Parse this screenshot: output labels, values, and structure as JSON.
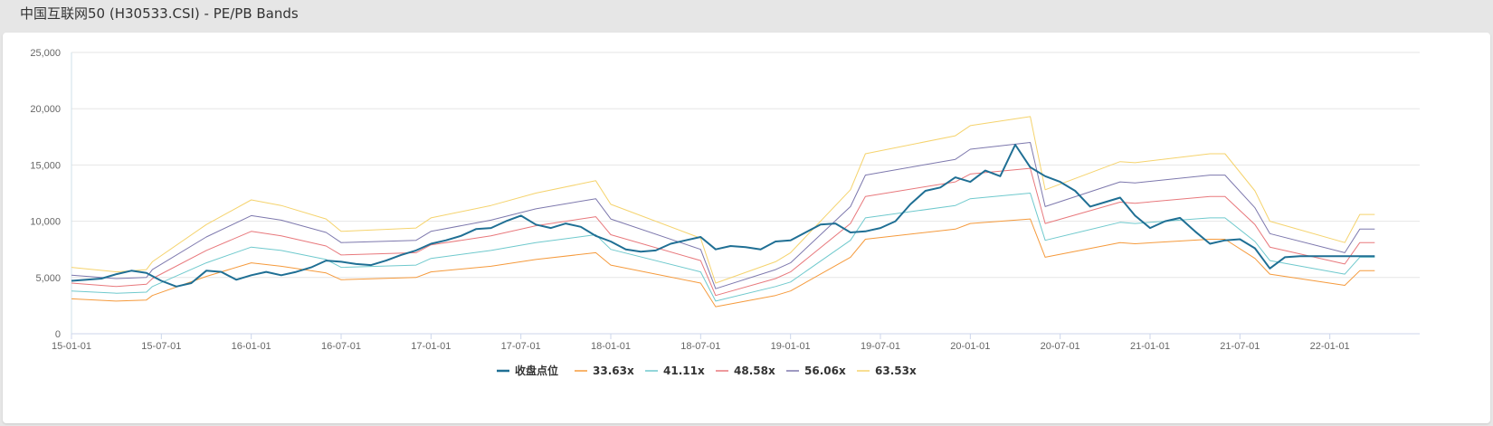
{
  "title": "中国互联网50 (H30533.CSI) - PE/PB Bands",
  "chart_data": {
    "type": "line",
    "title": "中国互联网50 (H30533.CSI) - PE/PB Bands",
    "xlabel": "",
    "ylabel": "",
    "x_ticks": [
      "15-01-01",
      "15-07-01",
      "16-01-01",
      "16-07-01",
      "17-01-01",
      "17-07-01",
      "18-01-01",
      "18-07-01",
      "19-01-01",
      "19-07-01",
      "20-01-01",
      "20-07-01",
      "21-01-01",
      "21-07-01",
      "22-01-01"
    ],
    "ylim": [
      0,
      25000
    ],
    "y_ticks": [
      0,
      5000,
      10000,
      15000,
      20000,
      25000
    ],
    "y_tick_labels": [
      "0",
      "5,000",
      "10,000",
      "15,000",
      "20,000",
      "25,000"
    ],
    "grid": true,
    "legend_position": "bottom",
    "x_unit": "months since 2015-01",
    "series": [
      {
        "name": "收盘点位",
        "color": "#1f6f94",
        "width": 2,
        "x": [
          0,
          1,
          2,
          3,
          4,
          5,
          6,
          7,
          8,
          9,
          10,
          11,
          12,
          13,
          14,
          15,
          16,
          17,
          18,
          19,
          20,
          21,
          22,
          23,
          24,
          25,
          26,
          27,
          28,
          29,
          30,
          31,
          32,
          33,
          34,
          35,
          36,
          37,
          38,
          39,
          40,
          41,
          42,
          43,
          44,
          45,
          46,
          47,
          48,
          49,
          50,
          51,
          52,
          53,
          54,
          55,
          56,
          57,
          58,
          59,
          60,
          61,
          62,
          63,
          64,
          65,
          66,
          67,
          68,
          69,
          70,
          71,
          72,
          73,
          74,
          75,
          76,
          77,
          78,
          79,
          80,
          81,
          82,
          83,
          84,
          85,
          86,
          87
        ],
        "values": [
          4700,
          4800,
          4900,
          5300,
          5600,
          5400,
          4700,
          4200,
          4500,
          5600,
          5500,
          4800,
          5200,
          5500,
          5200,
          5500,
          5900,
          6500,
          6400,
          6200,
          6100,
          6500,
          7000,
          7400,
          8000,
          8300,
          8700,
          9300,
          9400,
          10000,
          10500,
          9700,
          9400,
          9800,
          9500,
          8700,
          8200,
          7500,
          7300,
          7400,
          8000,
          8300,
          8600,
          7500,
          7800,
          7700,
          7500,
          8200,
          8300,
          9000,
          9700,
          9800,
          9000,
          9100,
          9400,
          10000,
          11500,
          12700,
          13000,
          13900,
          13500,
          14500,
          14000,
          16800,
          14800,
          14000,
          13500,
          12700,
          11300,
          11700,
          12100,
          10500,
          9400,
          10000,
          10300,
          9100,
          8000,
          8300,
          8400,
          7600,
          5800,
          6800,
          6900,
          6900,
          6900,
          6900,
          6900,
          6900
        ]
      },
      {
        "name": "33.63x",
        "color": "#f59a3c",
        "width": 1,
        "x": [
          0,
          3,
          5,
          5.4,
          9,
          12,
          14,
          17,
          18,
          23,
          24,
          28,
          31,
          35,
          36,
          42,
          43,
          47,
          48,
          52,
          53,
          59,
          60,
          64,
          65,
          70,
          71,
          76,
          77,
          79,
          80,
          85,
          86,
          87
        ],
        "values": [
          3100,
          2900,
          3000,
          3400,
          5100,
          6300,
          6000,
          5400,
          4800,
          5000,
          5500,
          6000,
          6600,
          7200,
          6100,
          4500,
          2400,
          3400,
          3800,
          6800,
          8400,
          9300,
          9800,
          10200,
          6800,
          8100,
          8000,
          8400,
          8400,
          6700,
          5300,
          4300,
          5600,
          5600
        ]
      },
      {
        "name": "41.11x",
        "color": "#6fc9cd",
        "width": 1,
        "x": [
          0,
          3,
          5,
          5.4,
          9,
          12,
          14,
          17,
          18,
          23,
          24,
          28,
          31,
          35,
          36,
          42,
          43,
          47,
          48,
          52,
          53,
          59,
          60,
          64,
          65,
          70,
          71,
          76,
          77,
          79,
          80,
          85,
          86,
          87
        ],
        "values": [
          3800,
          3600,
          3700,
          4200,
          6300,
          7700,
          7400,
          6600,
          5900,
          6100,
          6700,
          7400,
          8100,
          8800,
          7500,
          5500,
          2900,
          4200,
          4600,
          8300,
          10300,
          11400,
          12000,
          12500,
          8300,
          9900,
          9800,
          10300,
          10300,
          8200,
          6500,
          5300,
          6800,
          6800
        ]
      },
      {
        "name": "48.58x",
        "color": "#e8787c",
        "width": 1,
        "x": [
          0,
          3,
          5,
          5.4,
          9,
          12,
          14,
          17,
          18,
          23,
          24,
          28,
          31,
          35,
          36,
          42,
          43,
          47,
          48,
          52,
          53,
          59,
          60,
          64,
          65,
          70,
          71,
          76,
          77,
          79,
          80,
          85,
          86,
          87
        ],
        "values": [
          4500,
          4200,
          4400,
          4900,
          7400,
          9100,
          8700,
          7800,
          7000,
          7200,
          7900,
          8700,
          9600,
          10400,
          8800,
          6500,
          3400,
          4900,
          5500,
          9800,
          12200,
          13500,
          14200,
          14700,
          9800,
          11700,
          11600,
          12200,
          12200,
          9700,
          7700,
          6200,
          8100,
          8100
        ]
      },
      {
        "name": "56.06x",
        "color": "#7d78ad",
        "width": 1,
        "x": [
          0,
          3,
          5,
          5.4,
          9,
          12,
          14,
          17,
          18,
          23,
          24,
          28,
          31,
          35,
          36,
          42,
          43,
          47,
          48,
          52,
          53,
          59,
          60,
          64,
          65,
          70,
          71,
          76,
          77,
          79,
          80,
          85,
          86,
          87
        ],
        "values": [
          5200,
          4900,
          5000,
          5700,
          8600,
          10500,
          10100,
          9000,
          8100,
          8300,
          9100,
          10100,
          11100,
          12000,
          10200,
          7500,
          4000,
          5700,
          6300,
          11300,
          14100,
          15500,
          16400,
          17000,
          11300,
          13500,
          13400,
          14100,
          14100,
          11200,
          8900,
          7200,
          9300,
          9300
        ]
      },
      {
        "name": "63.53x",
        "color": "#f5d36d",
        "width": 1,
        "x": [
          0,
          3,
          5,
          5.4,
          9,
          12,
          14,
          17,
          18,
          23,
          24,
          28,
          31,
          35,
          36,
          42,
          43,
          47,
          48,
          52,
          53,
          59,
          60,
          64,
          65,
          70,
          71,
          76,
          77,
          79,
          80,
          85,
          86,
          87
        ],
        "values": [
          5900,
          5500,
          5700,
          6400,
          9700,
          11900,
          11400,
          10200,
          9100,
          9400,
          10300,
          11400,
          12500,
          13600,
          11500,
          8500,
          4500,
          6400,
          7200,
          12800,
          16000,
          17600,
          18500,
          19300,
          12800,
          15300,
          15200,
          16000,
          16000,
          12700,
          10000,
          8100,
          10600,
          10600
        ]
      }
    ]
  }
}
